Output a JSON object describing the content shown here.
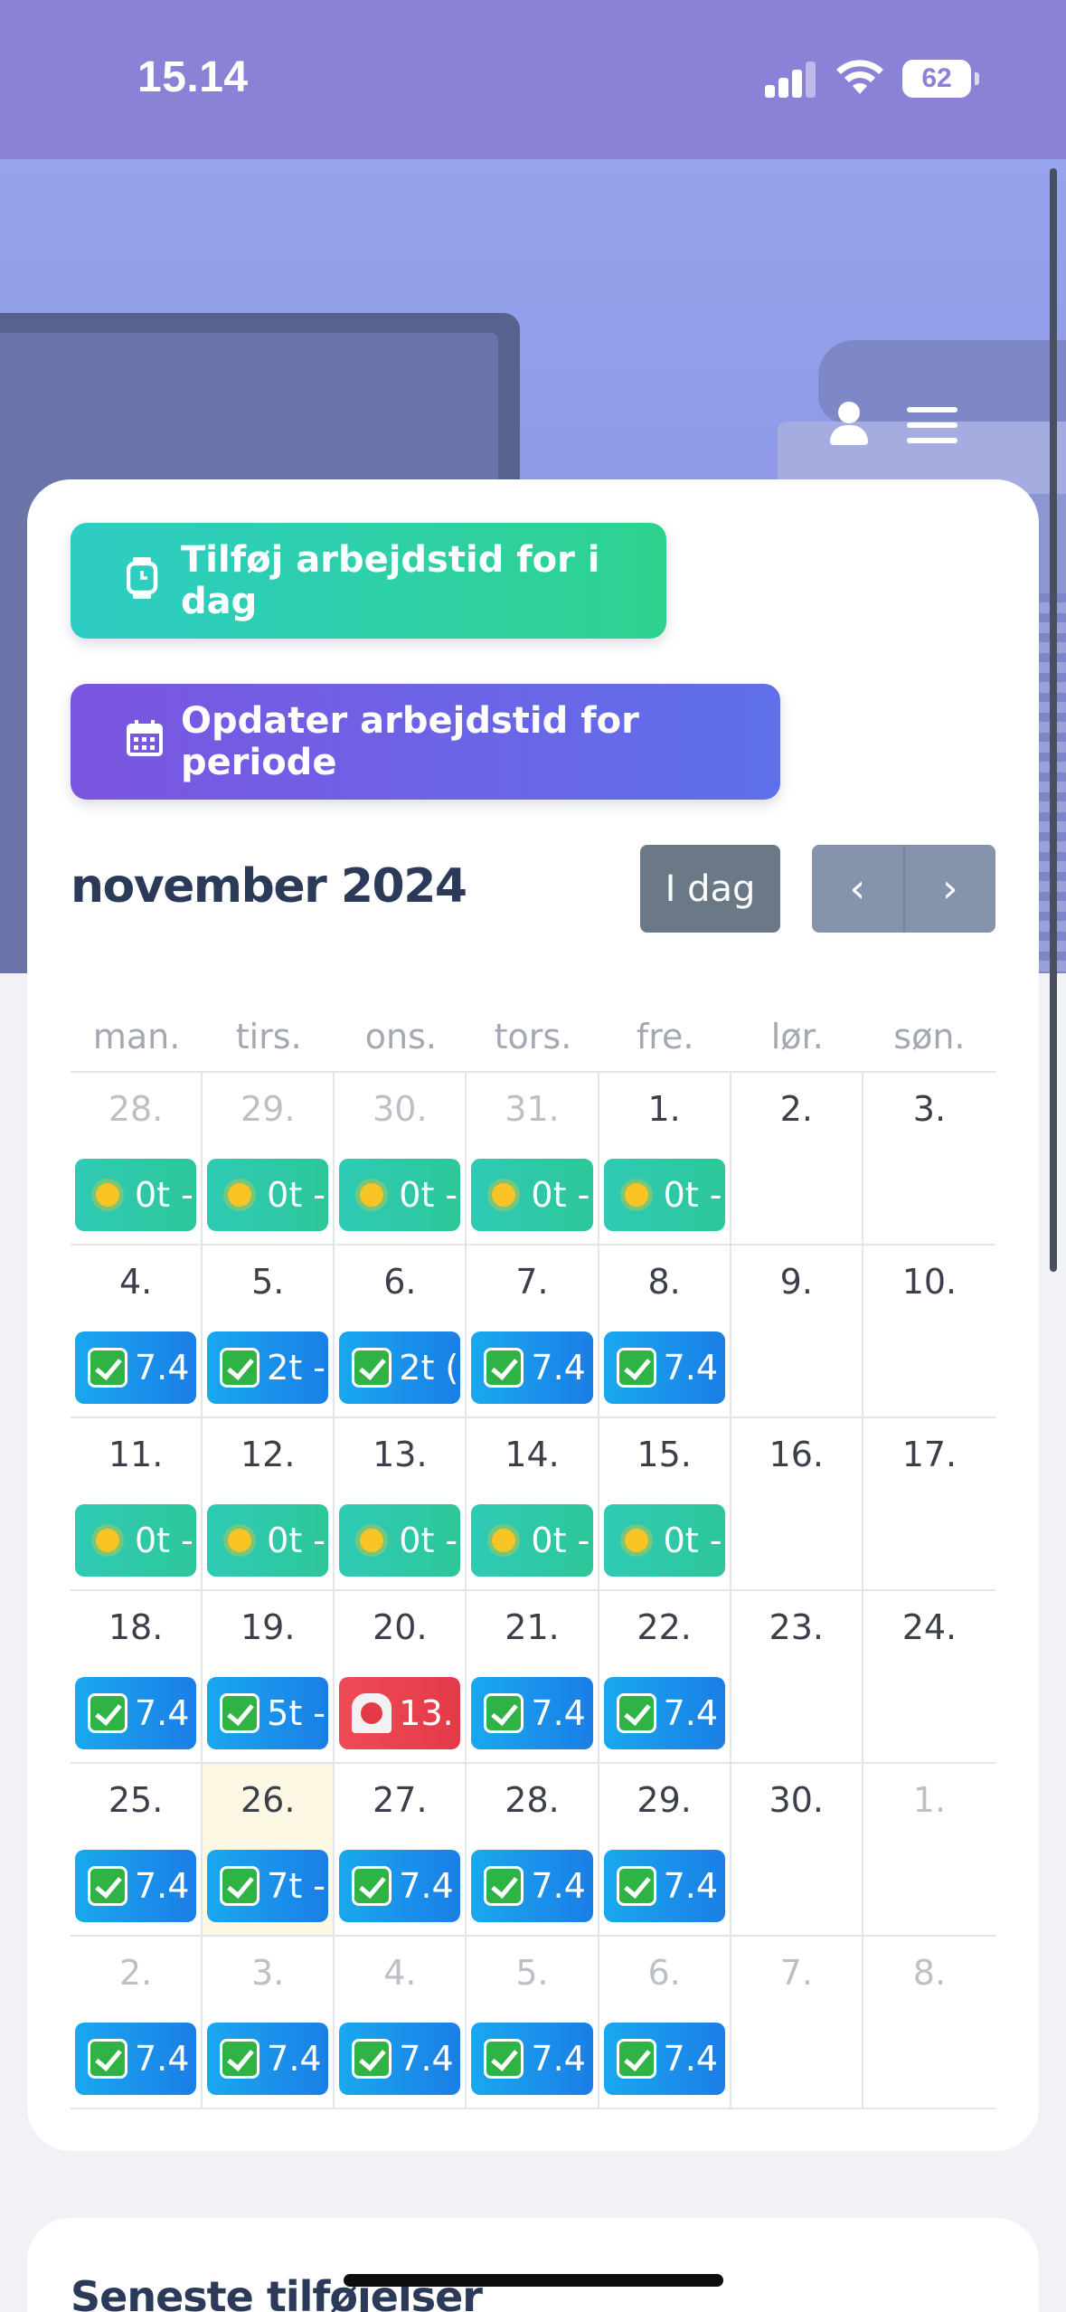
{
  "status_bar": {
    "time": "15.14",
    "battery": "62"
  },
  "header": {
    "user_icon": "user-icon",
    "menu_icon": "hamburger-menu-icon"
  },
  "actions": {
    "add_today_label": "Tilføj arbejdstid for i dag",
    "update_period_label": "Opdater arbejdstid for periode"
  },
  "calendar": {
    "month_title": "november 2024",
    "today_label": "I dag",
    "prev_label": "‹",
    "next_label": "›",
    "weekdays": [
      "man.",
      "tirs.",
      "ons.",
      "tors.",
      "fre.",
      "lør.",
      "søn."
    ],
    "weeks": [
      [
        {
          "day": "28.",
          "out": true,
          "event": {
            "type": "sun",
            "text": "0t -"
          }
        },
        {
          "day": "29.",
          "out": true,
          "event": {
            "type": "sun",
            "text": "0t -"
          }
        },
        {
          "day": "30.",
          "out": true,
          "event": {
            "type": "sun",
            "text": "0t -"
          }
        },
        {
          "day": "31.",
          "out": true,
          "event": {
            "type": "sun",
            "text": "0t -"
          }
        },
        {
          "day": "1.",
          "out": false,
          "event": {
            "type": "sun",
            "text": "0t -"
          }
        },
        {
          "day": "2.",
          "out": false
        },
        {
          "day": "3.",
          "out": false
        }
      ],
      [
        {
          "day": "4.",
          "out": false,
          "event": {
            "type": "check",
            "text": "7.4"
          }
        },
        {
          "day": "5.",
          "out": false,
          "event": {
            "type": "check",
            "text": "2t -"
          }
        },
        {
          "day": "6.",
          "out": false,
          "event": {
            "type": "check",
            "text": "2t ("
          }
        },
        {
          "day": "7.",
          "out": false,
          "event": {
            "type": "check",
            "text": "7.4"
          }
        },
        {
          "day": "8.",
          "out": false,
          "event": {
            "type": "check",
            "text": "7.4"
          }
        },
        {
          "day": "9.",
          "out": false
        },
        {
          "day": "10.",
          "out": false
        }
      ],
      [
        {
          "day": "11.",
          "out": false,
          "event": {
            "type": "sun",
            "text": "0t -"
          }
        },
        {
          "day": "12.",
          "out": false,
          "event": {
            "type": "sun",
            "text": "0t -"
          }
        },
        {
          "day": "13.",
          "out": false,
          "event": {
            "type": "sun",
            "text": "0t -"
          }
        },
        {
          "day": "14.",
          "out": false,
          "event": {
            "type": "sun",
            "text": "0t -"
          }
        },
        {
          "day": "15.",
          "out": false,
          "event": {
            "type": "sun",
            "text": "0t -"
          }
        },
        {
          "day": "16.",
          "out": false
        },
        {
          "day": "17.",
          "out": false
        }
      ],
      [
        {
          "day": "18.",
          "out": false,
          "event": {
            "type": "check",
            "text": "7.4"
          }
        },
        {
          "day": "19.",
          "out": false,
          "event": {
            "type": "check",
            "text": "5t -"
          }
        },
        {
          "day": "20.",
          "out": false,
          "event": {
            "type": "alarm",
            "text": "13."
          }
        },
        {
          "day": "21.",
          "out": false,
          "event": {
            "type": "check",
            "text": "7.4"
          }
        },
        {
          "day": "22.",
          "out": false,
          "event": {
            "type": "check",
            "text": "7.4"
          }
        },
        {
          "day": "23.",
          "out": false
        },
        {
          "day": "24.",
          "out": false
        }
      ],
      [
        {
          "day": "25.",
          "out": false,
          "event": {
            "type": "check",
            "text": "7.4"
          }
        },
        {
          "day": "26.",
          "out": false,
          "today": true,
          "event": {
            "type": "check",
            "text": "7t -"
          }
        },
        {
          "day": "27.",
          "out": false,
          "event": {
            "type": "check",
            "text": "7.4"
          }
        },
        {
          "day": "28.",
          "out": false,
          "event": {
            "type": "check",
            "text": "7.4"
          }
        },
        {
          "day": "29.",
          "out": false,
          "event": {
            "type": "check",
            "text": "7.4"
          }
        },
        {
          "day": "30.",
          "out": false
        },
        {
          "day": "1.",
          "out": true
        }
      ],
      [
        {
          "day": "2.",
          "out": true,
          "event": {
            "type": "check",
            "text": "7.4"
          }
        },
        {
          "day": "3.",
          "out": true,
          "event": {
            "type": "check",
            "text": "7.4"
          }
        },
        {
          "day": "4.",
          "out": true,
          "event": {
            "type": "check",
            "text": "7.4"
          }
        },
        {
          "day": "5.",
          "out": true,
          "event": {
            "type": "check",
            "text": "7.4"
          }
        },
        {
          "day": "6.",
          "out": true,
          "event": {
            "type": "check",
            "text": "7.4"
          }
        },
        {
          "day": "7.",
          "out": true
        },
        {
          "day": "8.",
          "out": true
        }
      ]
    ]
  },
  "recent": {
    "title": "Seneste tilføjelser"
  },
  "colors": {
    "status_bar": "#8a82d6",
    "add_today_start": "#2dcdc5",
    "add_today_end": "#2ed28e",
    "period_start": "#7b55e0",
    "period_end": "#5f70ea",
    "check_event": "#1b8ee9",
    "sun_event": "#2fcab5",
    "alarm_event": "#e8434f",
    "today_highlight": "#fcf8e3"
  }
}
